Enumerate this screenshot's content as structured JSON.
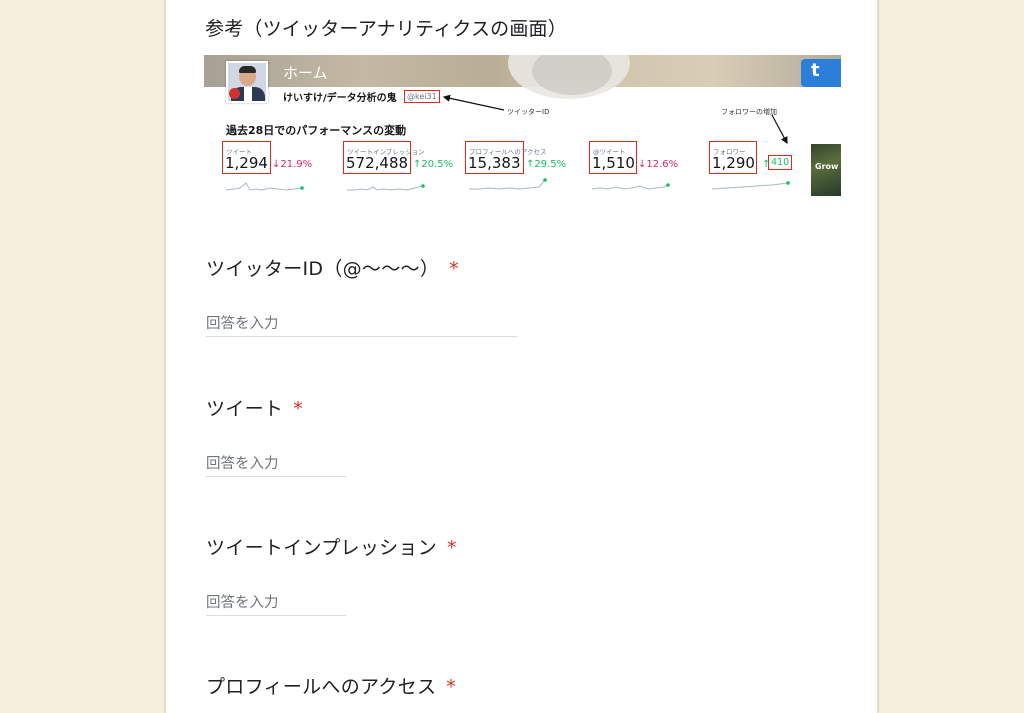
{
  "reference": {
    "title": "参考（ツイッターアナリティクスの画面）",
    "screenshot": {
      "home_label": "ホーム",
      "user_name": "けいすけ/データ分析の鬼",
      "handle": "@kei31",
      "annotation_id": "ツイッターID",
      "annotation_followers": "フォロワーの増加",
      "performance_title": "過去28日でのパフォーマンスの変動",
      "thumbnail_text": "Grow",
      "stats": [
        {
          "label": "ツイート",
          "value": "1,294",
          "change": "↓21.9%",
          "direction": "down"
        },
        {
          "label": "ツイートインプレッション",
          "value": "572,488",
          "change": "↑20.5%",
          "direction": "up"
        },
        {
          "label": "プロフィールへのアクセス",
          "value": "15,383",
          "change": "↑29.5%",
          "direction": "up"
        },
        {
          "label": "@ツイート",
          "value": "1,510",
          "change": "↓12.6%",
          "direction": "down"
        },
        {
          "label": "フォロワー",
          "value": "1,290",
          "change": "410",
          "direction": "up"
        }
      ],
      "colors": {
        "highlight": "#e0281b",
        "up": "#17bf63",
        "down": "#e0245e",
        "brand_blue": "#2b7fd8"
      }
    }
  },
  "questions": [
    {
      "title": "ツイッターID（@〜〜〜）",
      "required_mark": "*",
      "placeholder": "回答を入力"
    },
    {
      "title": "ツイート",
      "required_mark": "*",
      "placeholder": "回答を入力"
    },
    {
      "title": "ツイートインプレッション",
      "required_mark": "*",
      "placeholder": "回答を入力"
    },
    {
      "title": "プロフィールへのアクセス",
      "required_mark": "*",
      "placeholder": ""
    }
  ]
}
